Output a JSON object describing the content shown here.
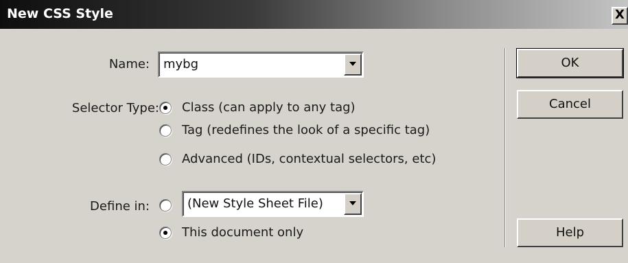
{
  "window": {
    "title": "New CSS Style",
    "close_glyph": "X"
  },
  "name_field": {
    "label": "Name:",
    "value": "mybg"
  },
  "selector_type": {
    "label": "Selector Type:",
    "options": [
      {
        "label": "Class (can apply to any tag)",
        "selected": true
      },
      {
        "label": "Tag (redefines the look of a specific tag)",
        "selected": false
      },
      {
        "label": "Advanced (IDs, contextual selectors, etc)",
        "selected": false
      }
    ]
  },
  "define_in": {
    "label": "Define in:",
    "file_option_selected": false,
    "file_select_value": "(New Style Sheet File)",
    "document_only_label": "This document only",
    "document_only_selected": true
  },
  "buttons": {
    "ok": "OK",
    "cancel": "Cancel",
    "help": "Help"
  }
}
